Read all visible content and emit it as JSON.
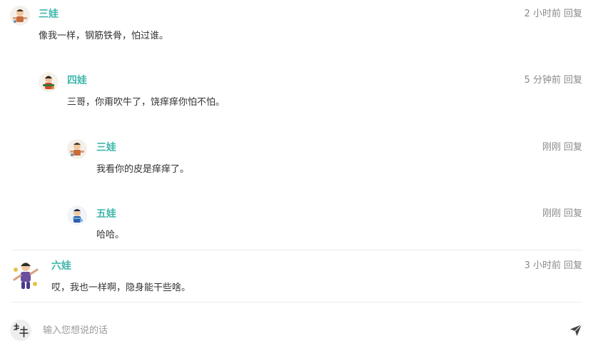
{
  "comments": [
    {
      "author": "三娃",
      "time": "2 小时前",
      "reply": "回复",
      "content": "像我一样，钢筋铁骨，怕过谁。",
      "avatar_icon": "gourd-brother-3-avatar"
    },
    {
      "author": "四娃",
      "time": "5 分钟前",
      "reply": "回复",
      "content": "三哥，你甭吹牛了，饶痒痒你怕不怕。",
      "avatar_icon": "gourd-brother-4-avatar"
    },
    {
      "author": "三娃",
      "time": "刚刚",
      "reply": "回复",
      "content": "我看你的皮是痒痒了。",
      "avatar_icon": "gourd-brother-3-avatar"
    },
    {
      "author": "五娃",
      "time": "刚刚",
      "reply": "回复",
      "content": "哈哈。",
      "avatar_icon": "gourd-brother-5-avatar"
    },
    {
      "author": "六娃",
      "time": "3 小时前",
      "reply": "回复",
      "content": "哎，我也一样啊，隐身能干些啥。",
      "avatar_icon": "gourd-brother-6-avatar"
    }
  ],
  "composer": {
    "placeholder": "输入您想说的话",
    "user_avatar_icon": "user-calligraphy-avatar",
    "send_icon": "send-icon"
  },
  "colors": {
    "author": "#3fb7ac",
    "meta": "#8a8a8a",
    "divider": "#ececec"
  }
}
